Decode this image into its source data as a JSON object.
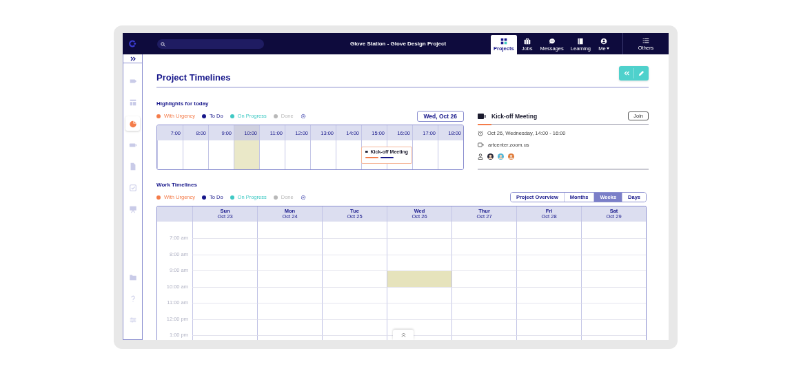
{
  "top_bar": {
    "title": "Glove Station - Glove Design Project",
    "nav": [
      {
        "label": "Projects",
        "selected": true
      },
      {
        "label": "Jobs",
        "selected": false
      },
      {
        "label": "Messages",
        "selected": false
      },
      {
        "label": "Learning",
        "selected": false
      },
      {
        "label": "Me",
        "selected": false
      }
    ],
    "others": {
      "label": "Others"
    }
  },
  "sidebar": {
    "items": [
      {
        "selected": false
      },
      {
        "selected": false
      },
      {
        "selected": true
      },
      {
        "selected": false
      },
      {
        "selected": false
      },
      {
        "selected": false
      },
      {
        "selected": false
      }
    ],
    "bottom_items": [
      {
        "selected": false
      },
      {
        "selected": false
      },
      {
        "selected": false
      }
    ]
  },
  "page_title": "Project Timelines",
  "highlights": {
    "title": "Highlights for today",
    "legend": [
      {
        "label": "With Urgency",
        "color": "#f47c4a"
      },
      {
        "label": "To Do",
        "color": "#16168a"
      },
      {
        "label": "On Progress",
        "color": "#3fc9c4"
      },
      {
        "label": "Done",
        "color": "#b8b8b8"
      }
    ],
    "date": "Wed, Oct 26",
    "hours": [
      {
        "label": "7:00",
        "highlighted": false
      },
      {
        "label": "8:00",
        "highlighted": false
      },
      {
        "label": "9:00",
        "highlighted": false
      },
      {
        "label": "10:00",
        "highlighted": true
      },
      {
        "label": "11:00",
        "highlighted": false
      },
      {
        "label": "12:00",
        "highlighted": false
      },
      {
        "label": "13:00",
        "highlighted": false
      },
      {
        "label": "14:00",
        "highlighted": false
      },
      {
        "label": "15:00",
        "highlighted": false,
        "event": {
          "title": "Kick-off Meeting",
          "statuses": [
            {
              "color": "#f47c4a"
            },
            {
              "color": "#16168a"
            }
          ]
        }
      },
      {
        "label": "16:00",
        "highlighted": false
      },
      {
        "label": "17:00",
        "highlighted": false
      },
      {
        "label": "18:00",
        "highlighted": false
      }
    ],
    "meeting": {
      "title": "Kick-off Meeting",
      "join": "Join",
      "when": "Oct 26, Wednesday, 14:00 - 16:00",
      "link": "artcenter.zoom.us",
      "attendees": [
        {
          "color": "#2a2a3a"
        },
        {
          "color": "#4fb6d8"
        },
        {
          "color": "#e07a3a"
        }
      ]
    }
  },
  "work_timelines": {
    "title": "Work Timelines",
    "legend": [
      {
        "label": "With Urgency",
        "color": "#f47c4a"
      },
      {
        "label": "To Do",
        "color": "#16168a"
      },
      {
        "label": "On Progress",
        "color": "#3fc9c4"
      },
      {
        "label": "Done",
        "color": "#b8b8b8"
      }
    ],
    "views": [
      {
        "label": "Project Overview",
        "selected": false
      },
      {
        "label": "Months",
        "selected": false
      },
      {
        "label": "Weeks",
        "selected": true
      },
      {
        "label": "Days",
        "selected": false
      }
    ],
    "days": [
      {
        "name": "Sun",
        "date": "Oct 23"
      },
      {
        "name": "Mon",
        "date": "Oct 24"
      },
      {
        "name": "Tue",
        "date": "Oct 25"
      },
      {
        "name": "Wed",
        "date": "Oct 26"
      },
      {
        "name": "Thur",
        "date": "Oct 27"
      },
      {
        "name": "Fri",
        "date": "Oct 28"
      },
      {
        "name": "Sat",
        "date": "Oct 29"
      }
    ],
    "rows": [
      {
        "time": "7:00 am",
        "cells": [
          {
            "highlighted": false
          },
          {
            "highlighted": false
          },
          {
            "highlighted": false
          },
          {
            "highlighted": false
          },
          {
            "highlighted": false
          },
          {
            "highlighted": false
          },
          {
            "highlighted": false
          }
        ]
      },
      {
        "time": "8:00 am",
        "cells": [
          {
            "highlighted": false
          },
          {
            "highlighted": false
          },
          {
            "highlighted": false
          },
          {
            "highlighted": false
          },
          {
            "highlighted": false
          },
          {
            "highlighted": false
          },
          {
            "highlighted": false
          }
        ]
      },
      {
        "time": "9:00 am",
        "cells": [
          {
            "highlighted": false
          },
          {
            "highlighted": false
          },
          {
            "highlighted": false
          },
          {
            "highlighted": true
          },
          {
            "highlighted": false
          },
          {
            "highlighted": false
          },
          {
            "highlighted": false
          }
        ]
      },
      {
        "time": "10:00 am",
        "cells": [
          {
            "highlighted": false
          },
          {
            "highlighted": false
          },
          {
            "highlighted": false
          },
          {
            "highlighted": false
          },
          {
            "highlighted": false
          },
          {
            "highlighted": false
          },
          {
            "highlighted": false
          }
        ]
      },
      {
        "time": "11:00 am",
        "cells": [
          {
            "highlighted": false
          },
          {
            "highlighted": false
          },
          {
            "highlighted": false
          },
          {
            "highlighted": false
          },
          {
            "highlighted": false
          },
          {
            "highlighted": false
          },
          {
            "highlighted": false
          }
        ]
      },
      {
        "time": "12:00 pm",
        "cells": [
          {
            "highlighted": false
          },
          {
            "highlighted": false
          },
          {
            "highlighted": false
          },
          {
            "highlighted": false
          },
          {
            "highlighted": false
          },
          {
            "highlighted": false
          },
          {
            "highlighted": false
          }
        ]
      },
      {
        "time": "1:00 pm",
        "cells": [
          {
            "highlighted": false
          },
          {
            "highlighted": false
          },
          {
            "highlighted": false
          },
          {
            "highlighted": false
          },
          {
            "highlighted": false
          },
          {
            "highlighted": false
          },
          {
            "highlighted": false
          }
        ]
      }
    ]
  }
}
